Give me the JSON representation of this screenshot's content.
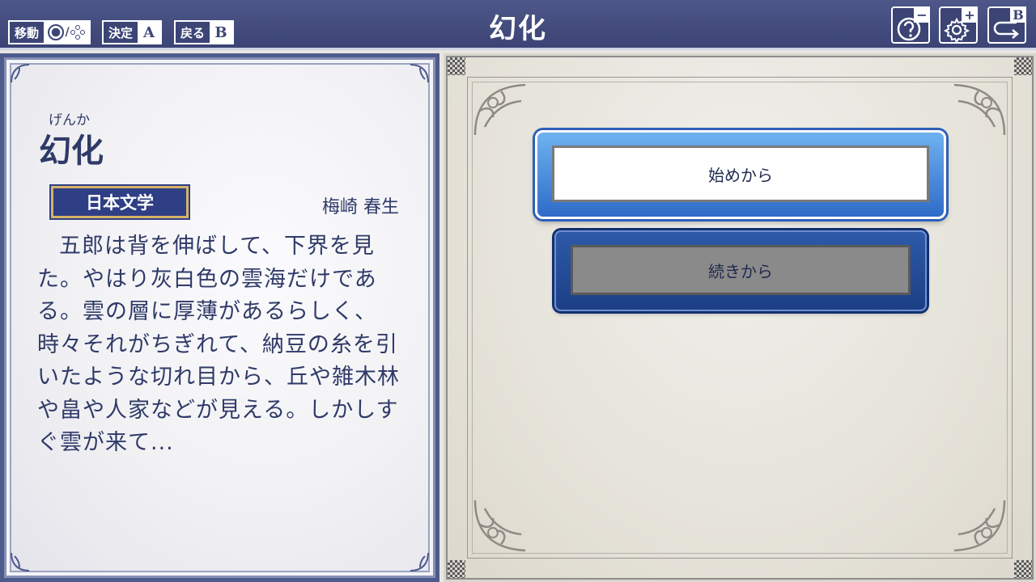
{
  "header": {
    "title": "幻化",
    "hints": [
      {
        "label": "移動",
        "key": "◯/⁘"
      },
      {
        "label": "決定",
        "key": "A"
      },
      {
        "label": "戻る",
        "key": "B"
      }
    ],
    "buttons": [
      {
        "icon": "help-icon",
        "badge": "−"
      },
      {
        "icon": "gear-icon",
        "badge": "+"
      },
      {
        "icon": "return-icon",
        "badge": "B"
      }
    ]
  },
  "work": {
    "furigana": "げんか",
    "title": "幻化",
    "genre": "日本文学",
    "author": "梅崎 春生",
    "excerpt": "五郎は背を伸ばして、下界を見た。やはり灰白色の雲海だけである。雲の層に厚薄があるらしく、時々それがちぎれて、納豆の糸を引いたような切れ目から、丘や雑木林や畠や人家などが見える。しかしすぐ雲が来て..."
  },
  "menu": {
    "start_label": "始めから",
    "continue_label": "続きから"
  },
  "colors": {
    "header_bg": "#3f4878",
    "text_navy": "#2f3a68",
    "button_blue": "#2f6bc8",
    "badge_gold": "#d6b266"
  }
}
